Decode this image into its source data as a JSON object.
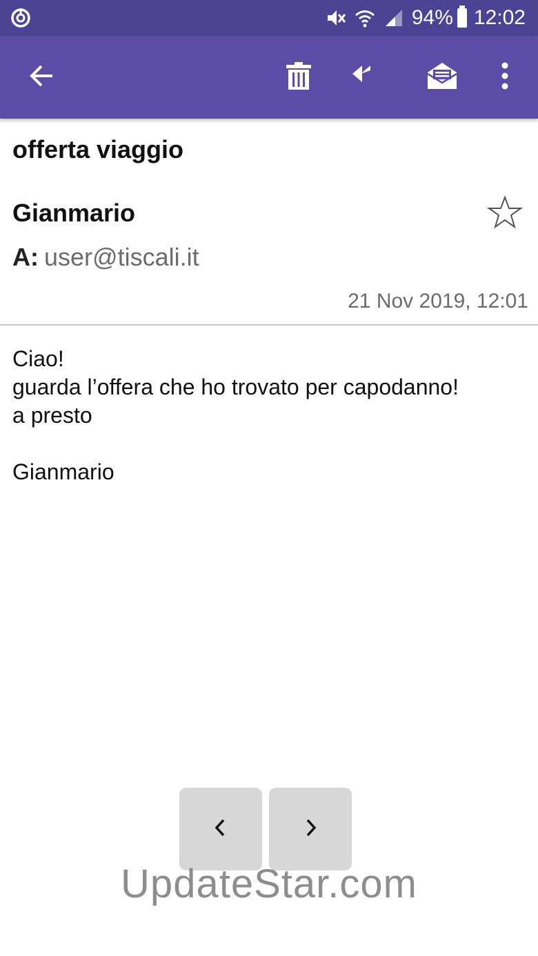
{
  "status_bar": {
    "battery": "94%",
    "time": "12:02",
    "icons": [
      "app-notification-icon",
      "mute-icon",
      "wifi-icon",
      "signal-icon",
      "battery-icon"
    ]
  },
  "toolbar": {
    "icons": [
      "back-arrow-icon",
      "trash-icon",
      "reply-all-icon",
      "mark-unread-icon",
      "more-vert-icon"
    ],
    "colors": {
      "statusbar": "#4b4394",
      "toolbar": "#5b4da6"
    }
  },
  "email": {
    "subject": "offerta viaggio",
    "sender": "Gianmario",
    "to_label": "A:",
    "to_value": "user@tiscali.it",
    "date": "21 Nov 2019, 12:01",
    "body_lines": [
      "Ciao!",
      "guarda l’offera che ho trovato per capodanno!",
      "a presto",
      "",
      "Gianmario"
    ]
  },
  "navigation": {
    "prev_icon": "chevron-left-icon",
    "next_icon": "chevron-right-icon"
  },
  "watermark": "UpdateStar.com"
}
